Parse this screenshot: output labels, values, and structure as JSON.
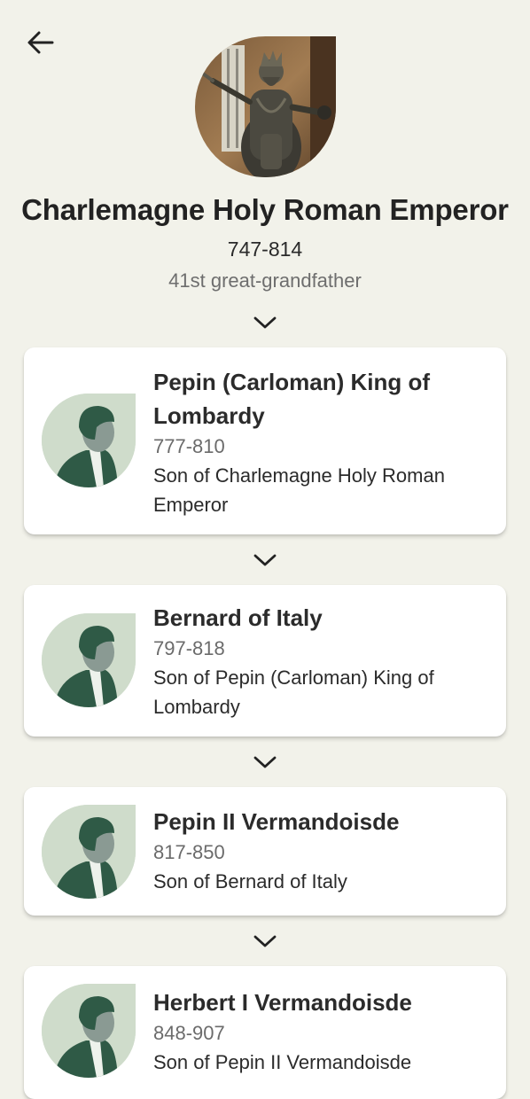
{
  "header": {
    "back_icon": "arrow-left-icon"
  },
  "focus_person": {
    "name": "Charlemagne Holy Roman Emperor",
    "dates": "747-814",
    "relationship": "41st great-grandfather",
    "photo": "statue-photo"
  },
  "expand_icon": "chevron-down-icon",
  "colors": {
    "background": "#f2f2ea",
    "card": "#ffffff",
    "avatar_bg": "#cfdccb",
    "avatar_figure": "#2f5a46",
    "avatar_face": "#8a9a93"
  },
  "lineage": [
    {
      "name": "Pepin (Carloman) King of Lombardy",
      "dates": "777-810",
      "relation": "Son of Charlemagne Holy Roman Emperor"
    },
    {
      "name": "Bernard of Italy",
      "dates": "797-818",
      "relation": "Son of Pepin (Carloman) King of Lombardy"
    },
    {
      "name": "Pepin II Vermandoisde",
      "dates": "817-850",
      "relation": "Son of Bernard of Italy"
    },
    {
      "name": "Herbert I Vermandoisde",
      "dates": "848-907",
      "relation": "Son of Pepin II Vermandoisde"
    }
  ]
}
